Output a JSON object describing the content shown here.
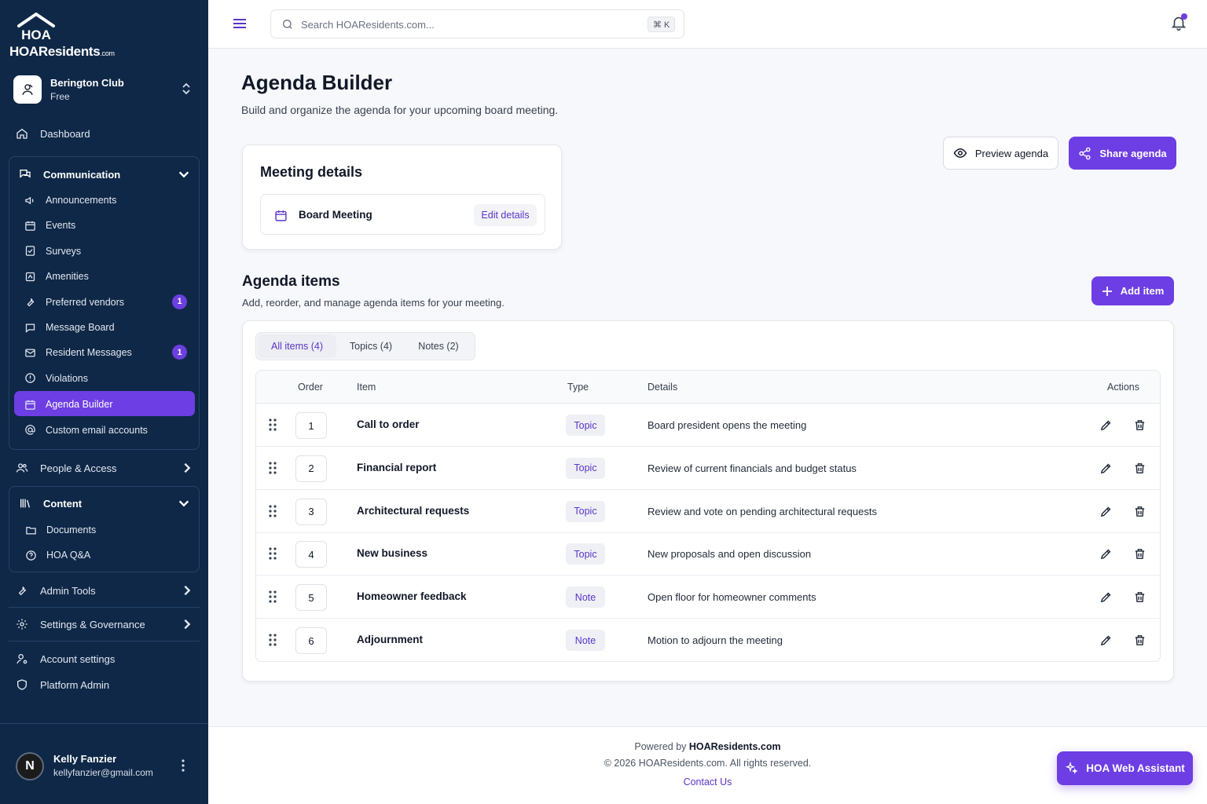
{
  "brand": {
    "name": "HOAResidents",
    "suffix": ".com",
    "logo_mark": "HOA"
  },
  "org": {
    "name": "Berington Club",
    "plan": "Free"
  },
  "nav": {
    "dashboard": "Dashboard",
    "communication": "Communication",
    "communication_items": [
      {
        "label": "Announcements",
        "icon": "megaphone-icon"
      },
      {
        "label": "Events",
        "icon": "calendar-icon"
      },
      {
        "label": "Surveys",
        "icon": "survey-icon"
      },
      {
        "label": "Amenities",
        "icon": "amenities-icon"
      },
      {
        "label": "Preferred vendors",
        "icon": "wrench-icon",
        "badge": "1"
      },
      {
        "label": "Message Board",
        "icon": "chat-bubble-icon"
      },
      {
        "label": "Resident Messages",
        "icon": "mail-icon",
        "badge": "1"
      },
      {
        "label": "Violations",
        "icon": "alert-circle-icon"
      },
      {
        "label": "Agenda Builder",
        "icon": "calendar-icon",
        "active": true
      },
      {
        "label": "Custom email accounts",
        "icon": "at-sign-icon"
      }
    ],
    "people_access": "People & Access",
    "content": "Content",
    "content_items": [
      {
        "label": "Documents",
        "icon": "folder-icon"
      },
      {
        "label": "HOA Q&A",
        "icon": "help-circle-icon"
      }
    ],
    "admin_tools": "Admin Tools",
    "settings_governance": "Settings & Governance",
    "account_settings": "Account settings",
    "platform_admin": "Platform Admin"
  },
  "user": {
    "initial": "N",
    "name": "Kelly Fanzier",
    "email": "kellyfanzier@gmail.com"
  },
  "search": {
    "placeholder": "Search HOAResidents.com...",
    "shortcut": "⌘ K"
  },
  "page": {
    "title": "Agenda Builder",
    "subtitle": "Build and organize the agenda for your upcoming board meeting.",
    "preview_label": "Preview agenda",
    "share_label": "Share agenda"
  },
  "meeting": {
    "title": "Meeting details",
    "name": "Board Meeting",
    "edit_label": "Edit details"
  },
  "agenda": {
    "title": "Agenda items",
    "subtitle": "Add, reorder, and manage agenda items for your meeting.",
    "add_label": "Add item",
    "tabs": [
      "All items (4)",
      "Topics (4)",
      "Notes (2)"
    ],
    "columns": {
      "order": "Order",
      "item": "Item",
      "type": "Type",
      "details": "Details",
      "actions": "Actions"
    },
    "rows": [
      {
        "order": "1",
        "item": "Call to order",
        "type": "Topic",
        "details": "Board president opens the meeting"
      },
      {
        "order": "2",
        "item": "Financial report",
        "type": "Topic",
        "details": "Review of current financials and budget status"
      },
      {
        "order": "3",
        "item": "Architectural requests",
        "type": "Topic",
        "details": "Review and vote on pending architectural requests"
      },
      {
        "order": "4",
        "item": "New business",
        "type": "Topic",
        "details": "New proposals and open discussion"
      },
      {
        "order": "5",
        "item": "Homeowner feedback",
        "type": "Note",
        "details": "Open floor for homeowner comments"
      },
      {
        "order": "6",
        "item": "Adjournment",
        "type": "Note",
        "details": "Motion to adjourn the meeting"
      }
    ]
  },
  "footer": {
    "powered_prefix": "Powered by",
    "powered_brand": "HOAResidents.com",
    "copyright": "© 2026 HOAResidents.com. All rights reserved.",
    "contact": "Contact Us"
  },
  "assistant": {
    "label": "HOA Web Assistant"
  },
  "colors": {
    "sidebar": "#0f2847",
    "accent": "#6d3ee3",
    "accent_text": "#5b34c9"
  }
}
